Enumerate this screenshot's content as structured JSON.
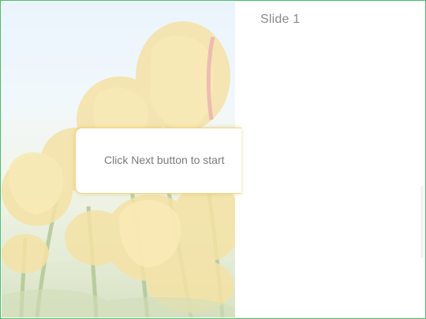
{
  "slide": {
    "title": "Slide 1"
  },
  "callout": {
    "text": "Click Next button to start"
  },
  "colors": {
    "frame_border": "#3fbf6a",
    "callout_border": "#f0d78a",
    "sky": "#e6f2fb",
    "petal": "#f6dc86"
  },
  "image": {
    "subject": "yellow tulips"
  }
}
